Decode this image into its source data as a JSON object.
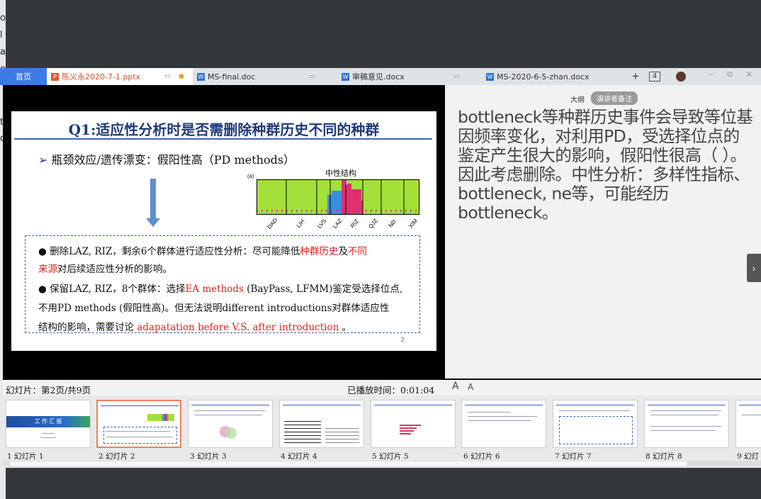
{
  "left_strip_chars": [
    "o",
    "l",
    "a",
    "e",
    "t",
    "d"
  ],
  "tabs": {
    "home": "首页",
    "items": [
      {
        "label": "陈义永2020-7-1.pptx",
        "type": "ppt"
      },
      {
        "label": "MS-final.doc",
        "type": "doc"
      },
      {
        "label": "审稿意见.docx",
        "type": "doc"
      },
      {
        "label": "MS-2020-6-5-zhan.docx",
        "type": "doc"
      }
    ],
    "count_badge": "4",
    "add": "+"
  },
  "slide": {
    "title": "Q1:适应性分析时是否需删除种群历史不同的种群",
    "subtitle": "瓶颈效应/遗传漂变：假阳性高（PD methods）",
    "figure_label": "(a)",
    "figure_title": "中性结构",
    "pop_labels": [
      "DAD",
      "LIH",
      "LVS",
      "LAZ",
      "RIZ",
      "QJZ",
      "ND",
      "XIM"
    ],
    "bullet1_a": "删除LAZ, RIZ，剩余6个群体进行适应性分析：尽可能降低",
    "bullet1_red1": "种群历史",
    "bullet1_b": "及",
    "bullet1_red2": "不同",
    "bullet1_red3": "来源",
    "bullet1_c": "对后续适应性分析的影响。",
    "bullet2_a": "保留LAZ, RIZ，8个群体：选择",
    "bullet2_red1": "EA methods",
    "bullet2_b": " (BayPass, LFMM)鉴定受选择位点,",
    "bullet2_line2": "不用PD methods (假阳性高)。但无法说明different introductions对群体适应性",
    "bullet2_c": "结构的影响，需要讨论 ",
    "bullet2_red2": "adapatation before V.S. after introduction",
    "bullet2_d": " 。",
    "page_num": "2"
  },
  "notes": {
    "tab_outline": "大纲",
    "tab_notes": "演讲者备注",
    "text": "bottleneck等种群历史事件会导致等位基因频率变化，对利用PD，受选择位点的鉴定产生很大的影响，假阳性很高（ ）。因此考虑删除。中性分析：多样性指标、bottleneck, ne等，可能经历bottleneck。"
  },
  "status": {
    "slide_info": "幻灯片：第2页/共9页",
    "elapsed": "已播放时间：0:01:04",
    "font_up": "A",
    "font_down": "A"
  },
  "thumbnails": [
    {
      "label": "1 幻灯片 1",
      "title": "工 作 汇 报"
    },
    {
      "label": "2 幻灯片 2"
    },
    {
      "label": "3 幻灯片 3"
    },
    {
      "label": "4 幻灯片 4"
    },
    {
      "label": "5 幻灯片 5"
    },
    {
      "label": "6 幻灯片 6"
    },
    {
      "label": "7 幻灯片 7"
    },
    {
      "label": "8 幻灯片 8"
    },
    {
      "label": "9 幻灯"
    }
  ],
  "colors": {
    "accent_blue": "#3c7be4",
    "slide_title": "#1f3a7a",
    "red_text": "#e02020",
    "notes_text": "#444444",
    "notes_tab_active": "#9a9a9a"
  }
}
